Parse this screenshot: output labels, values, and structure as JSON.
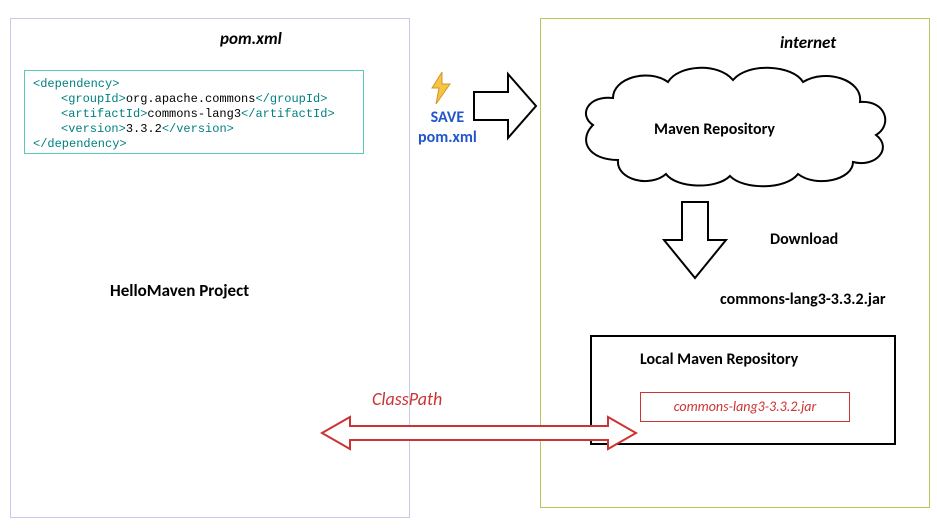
{
  "left": {
    "pom_title": "pom.xml",
    "project_label": "HelloMaven Project",
    "code": {
      "dep_open": "<dependency>",
      "group_open": "<groupId>",
      "group_val": "org.apache.commons",
      "group_close": "</groupId>",
      "artifact_open": "<artifactId>",
      "artifact_val": "commons-lang3",
      "artifact_close": "</artifactId>",
      "version_open": "<version>",
      "version_val": "3.3.2",
      "version_close": "</version>",
      "dep_close": "</dependency>"
    }
  },
  "center": {
    "save_line1": "SAVE",
    "save_line2": "pom.xml"
  },
  "right": {
    "internet": "internet",
    "cloud_label": "Maven Repository",
    "download": "Download",
    "jar_name": "commons-lang3-3.3.2.jar",
    "local_repo_title": "Local Maven Repository",
    "jar_box": "commons-lang3-3.3.2.jar"
  },
  "classpath": "ClassPath"
}
